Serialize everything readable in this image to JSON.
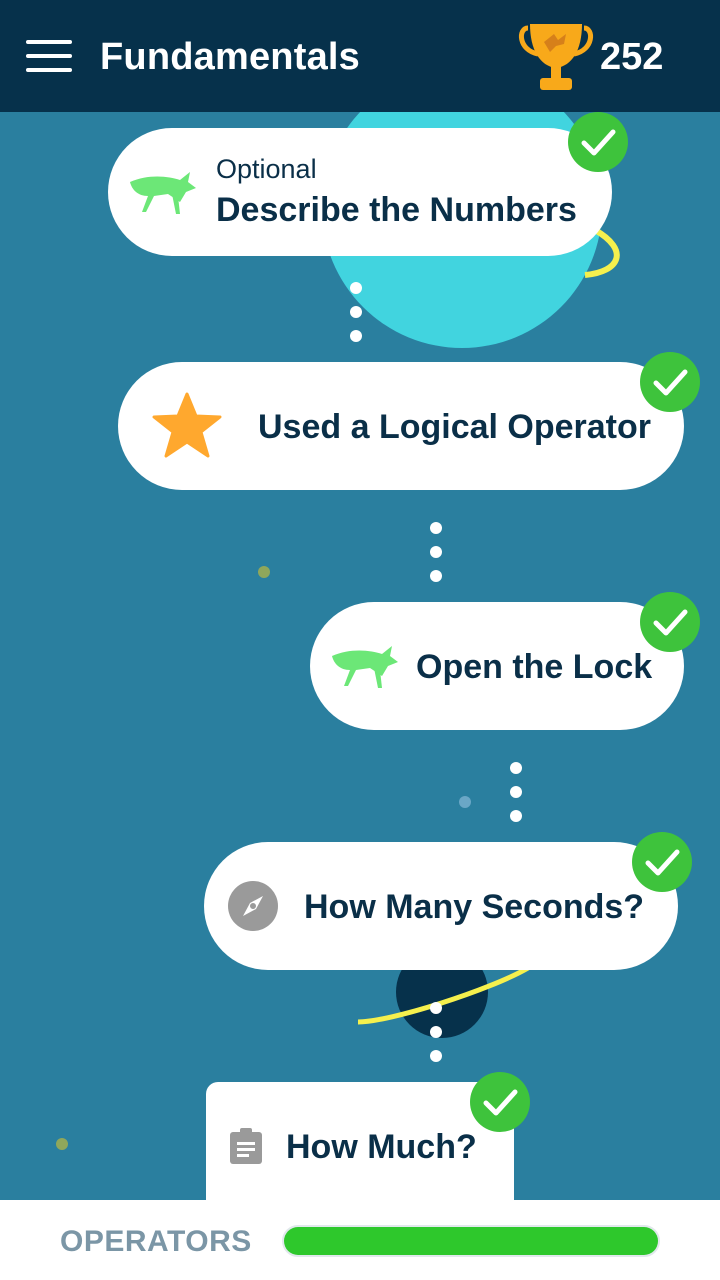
{
  "header": {
    "title": "Fundamentals",
    "points": "252",
    "menu_icon": "hamburger-menu-icon",
    "trophy_icon": "trophy-icon"
  },
  "colors": {
    "header_bg": "#06314b",
    "background": "#2a7f9f",
    "check_green": "#3ec33c",
    "grasshopper_green": "#6ce777",
    "star_orange": "#ffa82e",
    "text_dark": "#0a2f48"
  },
  "lessons": [
    {
      "label": "Describe the Numbers",
      "sublabel": "Optional",
      "icon": "grasshopper-icon",
      "completed": true
    },
    {
      "label": "Used a Logical Operator",
      "icon": "star-icon",
      "completed": true
    },
    {
      "label": "Open the Lock",
      "icon": "grasshopper-icon",
      "completed": true
    },
    {
      "label": "How Many Seconds?",
      "icon": "compass-icon",
      "completed": true
    },
    {
      "label": "How Much?",
      "icon": "clipboard-icon",
      "completed": true
    }
  ],
  "footer": {
    "label": "OPERATORS",
    "progress_percent": 100
  }
}
